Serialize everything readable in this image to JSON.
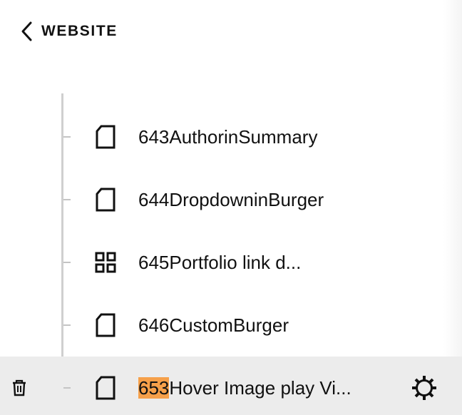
{
  "header": {
    "back_label": "WEBSITE"
  },
  "pages": [
    {
      "label": "643AuthorinSummary",
      "icon": "page-icon"
    },
    {
      "label": "644DropdowninBurger",
      "icon": "page-icon"
    },
    {
      "label": "645Portfolio link d...",
      "icon": "grid-icon"
    },
    {
      "label": "646CustomBurger",
      "icon": "page-icon"
    }
  ],
  "selected_page": {
    "highlight": "653",
    "rest": "Hover Image play Vi...",
    "icon": "page-icon",
    "actions": [
      "trash-icon",
      "gear-icon"
    ]
  },
  "colors": {
    "highlight": "#f6a04a",
    "selected_row": "#ececec",
    "tree_line": "#cfcfcf"
  }
}
